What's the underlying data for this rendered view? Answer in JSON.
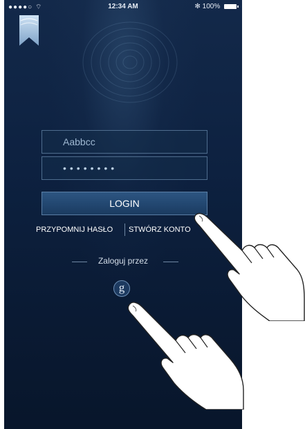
{
  "status_bar": {
    "signal": "●●●●○",
    "time": "12:34 AM",
    "battery_text": "100%"
  },
  "form": {
    "username_value": "Aabbcc",
    "password_value": "••••••••"
  },
  "login_button": "LOGIN",
  "links": {
    "remind_password": "PRZYPOMNIJ HASŁO",
    "create_account": "STWÓRZ KONTO"
  },
  "social": {
    "label": "Zaloguj przez",
    "google_glyph": "g",
    "icon": "google-icon"
  },
  "colors": {
    "background": "#0d2140",
    "field_border": "#4f6d8e",
    "button": "#234872"
  }
}
